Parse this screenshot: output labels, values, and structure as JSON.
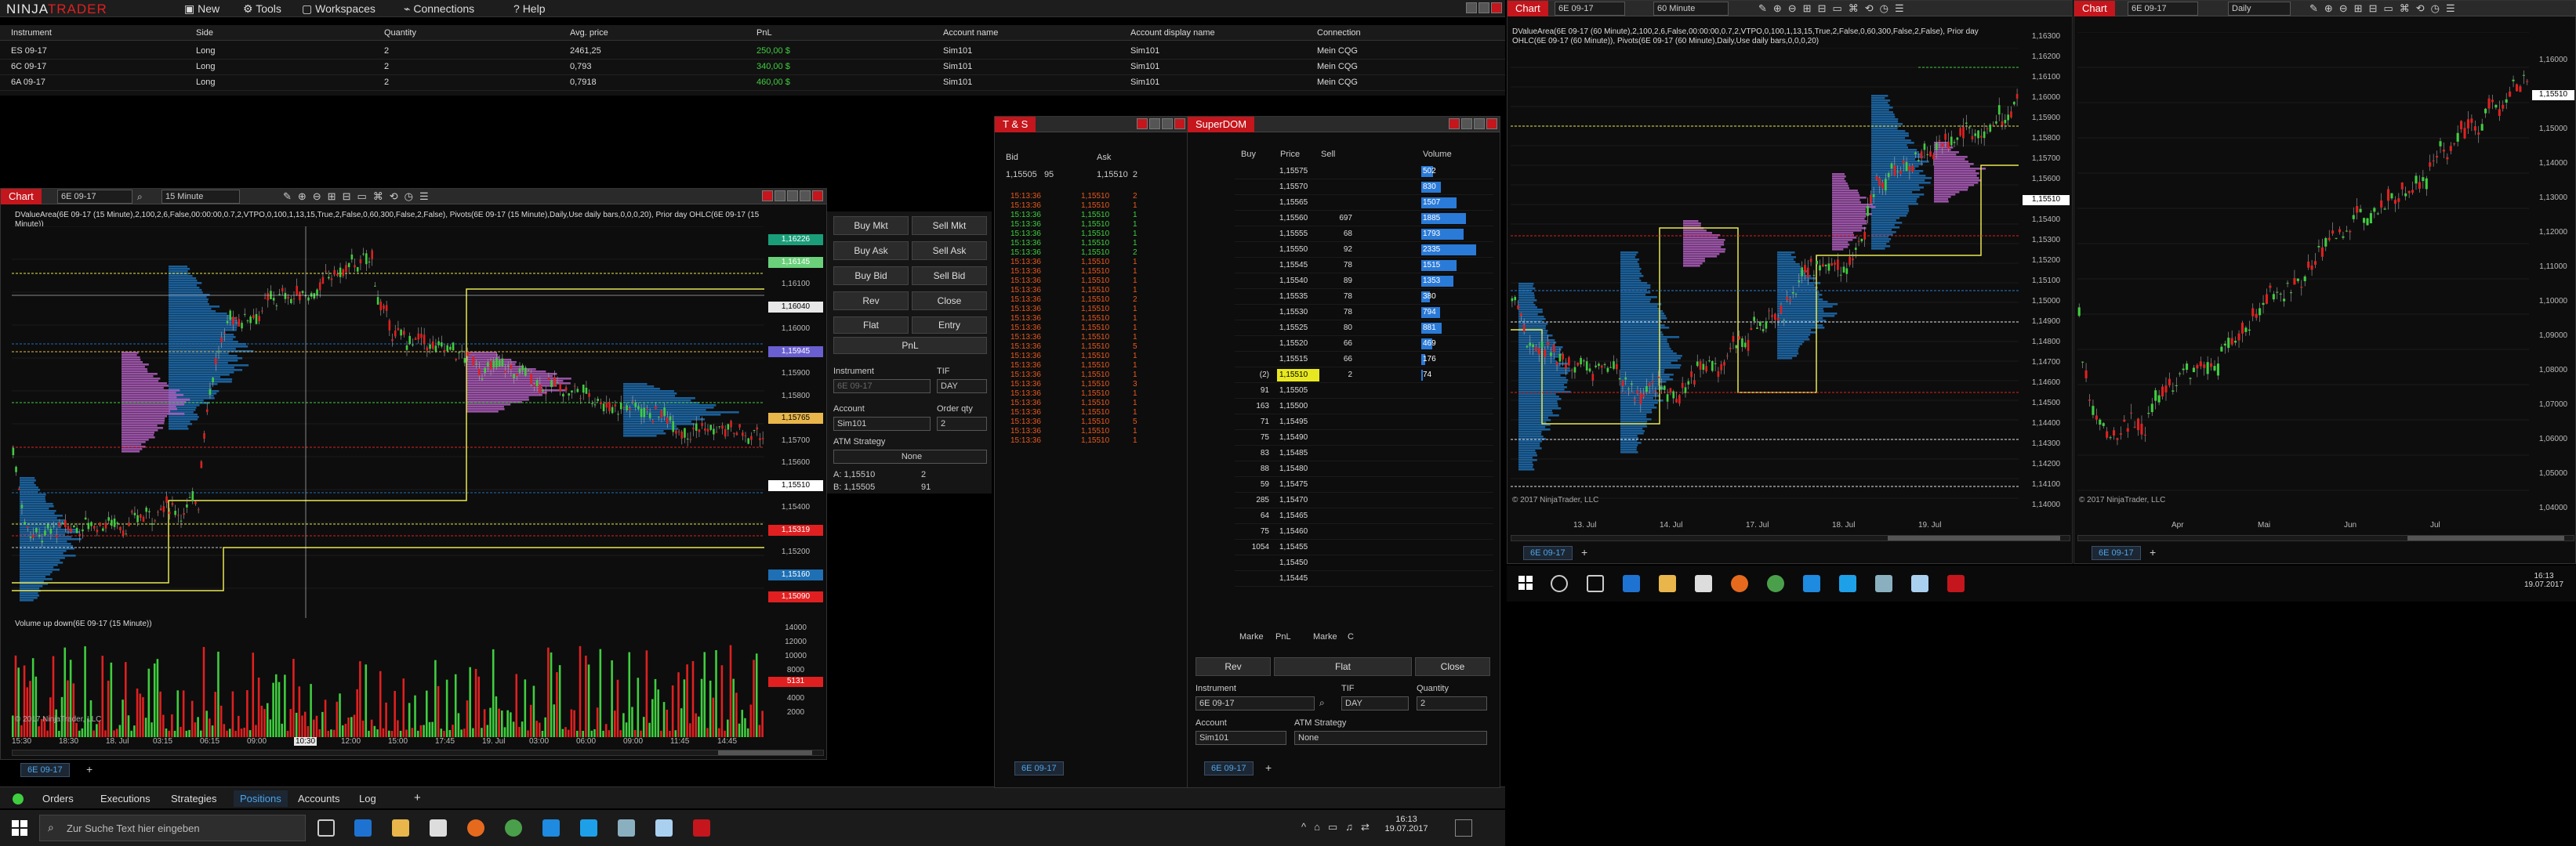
{
  "app": {
    "logo_left": "NINJA",
    "logo_right": "TRADER",
    "menu": [
      "New",
      "Tools",
      "Workspaces",
      "Connections",
      "Help"
    ]
  },
  "positions": {
    "headers": [
      "Instrument",
      "Side",
      "Quantity",
      "Avg. price",
      "PnL",
      "Account name",
      "Account display name",
      "Connection"
    ],
    "rows": [
      [
        "ES 09-17",
        "Long",
        "2",
        "2461,25",
        "250,00 $",
        "Sim101",
        "Sim101",
        "Mein CQG"
      ],
      [
        "6C 09-17",
        "Long",
        "2",
        "0,793",
        "340,00 $",
        "Sim101",
        "Sim101",
        "Mein CQG"
      ],
      [
        "6A 09-17",
        "Long",
        "2",
        "0,7918",
        "460,00 $",
        "Sim101",
        "Sim101",
        "Mein CQG"
      ]
    ]
  },
  "cc_tabs": [
    "Orders",
    "Executions",
    "Strategies",
    "Positions",
    "Accounts",
    "Log"
  ],
  "chart1": {
    "title": "Chart",
    "instrument": "6E 09-17",
    "interval": "15 Minute",
    "indicator_text": "DValueArea(6E 09-17 (15 Minute),2,100,2,6,False,00:00:00,0.7,2,VTPO,0,100,1,13,15,True,2,False,0,60,300,False,2,False), Pivots(6E 09-17 (15 Minute),Daily,Use daily bars,0,0,0,20), Prior day OHLC(6E 09-17 (15 Minute))",
    "price_labels": [
      "1,16226",
      "1,16145",
      "1,16100",
      "1,16040",
      "1,16000",
      "1,15945",
      "1,15900",
      "1,15800",
      "1,15765",
      "1,15700",
      "1,15600",
      "1,15510",
      "1,15400",
      "1,15319",
      "1,15200",
      "1,15160",
      "1,15090"
    ],
    "volume_title": "Volume up down(6E 09-17 (15 Minute))",
    "volume_labels": [
      "14000",
      "12000",
      "10000",
      "8000",
      "6000",
      "4000",
      "2000",
      "5131"
    ],
    "time_labels": [
      "15:30",
      "18:30",
      "18. Jul",
      "03:15",
      "06:15",
      "09:00",
      "10:30",
      "12:00",
      "15:00",
      "17:45",
      "19. Jul",
      "03:00",
      "06:00",
      "09:00",
      "11:45",
      "14:45"
    ],
    "copyright": "© 2017 NinjaTrader, LLC",
    "tab": "6E 09-17",
    "chart_trader": {
      "buttons": [
        "Buy Mkt",
        "Sell Mkt",
        "Buy Ask",
        "Sell Ask",
        "Buy Bid",
        "Sell Bid",
        "Rev",
        "Close"
      ],
      "flat": "Flat",
      "entry": "Entry",
      "pnl": "PnL",
      "instrument_label": "Instrument",
      "instrument_value": "6E 09-17",
      "tif_label": "TIF",
      "tif_value": "DAY",
      "account_label": "Account",
      "account_value": "Sim101",
      "qty_label": "Order qty",
      "qty_value": "2",
      "atm_label": "ATM Strategy",
      "atm_value": "None",
      "quote_a": "A: 1,15510",
      "quote_a_size": "2",
      "quote_b": "B: 1,15505",
      "quote_b_size": "91"
    }
  },
  "ts": {
    "title": "T & S",
    "col_bid": "Bid",
    "col_ask": "Ask",
    "bid": "1,15505",
    "bid_size": "95",
    "ask": "1,15510",
    "ask_size": "2",
    "tab": "6E 09-17",
    "rows": [
      [
        "15:13:36",
        "1,15510",
        "2",
        "r"
      ],
      [
        "15:13:36",
        "1,15510",
        "1",
        "r"
      ],
      [
        "15:13:36",
        "1,15510",
        "1",
        "g"
      ],
      [
        "15:13:36",
        "1,15510",
        "1",
        "g"
      ],
      [
        "15:13:36",
        "1,15510",
        "1",
        "g"
      ],
      [
        "15:13:36",
        "1,15510",
        "1",
        "g"
      ],
      [
        "15:13:36",
        "1,15510",
        "2",
        "g"
      ],
      [
        "15:13:36",
        "1,15510",
        "1",
        "r"
      ],
      [
        "15:13:36",
        "1,15510",
        "1",
        "r"
      ],
      [
        "15:13:36",
        "1,15510",
        "1",
        "r"
      ],
      [
        "15:13:36",
        "1,15510",
        "1",
        "r"
      ],
      [
        "15:13:36",
        "1,15510",
        "2",
        "r"
      ],
      [
        "15:13:36",
        "1,15510",
        "1",
        "r"
      ],
      [
        "15:13:36",
        "1,15510",
        "1",
        "r"
      ],
      [
        "15:13:36",
        "1,15510",
        "1",
        "r"
      ],
      [
        "15:13:36",
        "1,15510",
        "1",
        "r"
      ],
      [
        "15:13:36",
        "1,15510",
        "5",
        "r"
      ],
      [
        "15:13:36",
        "1,15510",
        "1",
        "r"
      ],
      [
        "15:13:36",
        "1,15510",
        "1",
        "r"
      ],
      [
        "15:13:36",
        "1,15510",
        "1",
        "r"
      ],
      [
        "15:13:36",
        "1,15510",
        "3",
        "r"
      ],
      [
        "15:13:36",
        "1,15510",
        "1",
        "r"
      ],
      [
        "15:13:36",
        "1,15510",
        "1",
        "r"
      ],
      [
        "15:13:36",
        "1,15510",
        "1",
        "r"
      ],
      [
        "15:13:36",
        "1,15510",
        "5",
        "r"
      ],
      [
        "15:13:36",
        "1,15510",
        "1",
        "r"
      ],
      [
        "15:13:36",
        "1,15510",
        "1",
        "r"
      ]
    ]
  },
  "superdom": {
    "title": "SuperDOM",
    "headers": [
      "Buy",
      "Price",
      "Sell",
      "Volume"
    ],
    "rows": [
      [
        "",
        "1,15575",
        "",
        "502"
      ],
      [
        "",
        "1,15570",
        "",
        "830"
      ],
      [
        "",
        "1,15565",
        "",
        "1507"
      ],
      [
        "",
        "1,15560",
        "697",
        "1885"
      ],
      [
        "",
        "1,15555",
        "68",
        "1793"
      ],
      [
        "",
        "1,15550",
        "92",
        "2335"
      ],
      [
        "",
        "1,15545",
        "78",
        "1515"
      ],
      [
        "",
        "1,15540",
        "89",
        "1353"
      ],
      [
        "",
        "1,15535",
        "78",
        "380"
      ],
      [
        "",
        "1,15530",
        "78",
        "794"
      ],
      [
        "",
        "1,15525",
        "80",
        "881"
      ],
      [
        "",
        "1,15520",
        "66",
        "469"
      ],
      [
        "",
        "1,15515",
        "66",
        "176"
      ],
      [
        "(2)",
        "1,15510",
        "2",
        "74"
      ],
      [
        "91",
        "1,15505",
        "",
        ""
      ],
      [
        "163",
        "1,15500",
        "",
        ""
      ],
      [
        "71",
        "1,15495",
        "",
        ""
      ],
      [
        "75",
        "1,15490",
        "",
        ""
      ],
      [
        "83",
        "1,15485",
        "",
        ""
      ],
      [
        "88",
        "1,15480",
        "",
        ""
      ],
      [
        "59",
        "1,15475",
        "",
        ""
      ],
      [
        "285",
        "1,15470",
        "",
        ""
      ],
      [
        "64",
        "1,15465",
        "",
        ""
      ],
      [
        "75",
        "1,15460",
        "",
        ""
      ],
      [
        "1054",
        "1,15455",
        "",
        ""
      ],
      [
        "",
        "1,15450",
        "",
        ""
      ],
      [
        "",
        "1,15445",
        "",
        ""
      ]
    ],
    "volume_values": [
      502,
      830,
      1507,
      1885,
      1793,
      2335,
      1515,
      1353,
      380,
      794,
      881,
      469,
      176,
      74
    ],
    "footer": [
      "Marke",
      "PnL",
      "Marke",
      "C"
    ],
    "rev": "Rev",
    "flat": "Flat",
    "close": "Close",
    "instrument_label": "Instrument",
    "instrument_value": "6E 09-17",
    "tif_label": "TIF",
    "tif_value": "DAY",
    "qty_label": "Quantity",
    "qty_value": "2",
    "account_label": "Account",
    "account_value": "Sim101",
    "atm_label": "ATM Strategy",
    "atm_value": "None",
    "tab": "6E 09-17"
  },
  "chart2": {
    "title": "Chart",
    "instrument": "6E 09-17",
    "interval": "60 Minute",
    "indicator_text": "DValueArea(6E 09-17 (60 Minute),2,100,2,6,False,00:00:00,0.7,2,VTPO,0,100,1,13,15,True,2,False,0,60,300,False,2,False), Prior day OHLC(6E 09-17 (60 Minute)), Pivots(6E 09-17 (60 Minute),Daily,Use daily bars,0,0,0,20)",
    "price_labels": [
      "1,16300",
      "1,16200",
      "1,16100",
      "1,16000",
      "1,15900",
      "1,15800",
      "1,15700",
      "1,15600",
      "1,15510",
      "1,15400",
      "1,15300",
      "1,15200",
      "1,15100",
      "1,15000",
      "1,14900",
      "1,14800",
      "1,14700",
      "1,14600",
      "1,14500",
      "1,14400",
      "1,14300",
      "1,14200",
      "1,14100",
      "1,14000"
    ],
    "time_labels": [
      "13. Jul",
      "14. Jul",
      "17. Jul",
      "18. Jul",
      "19. Jul"
    ],
    "copyright": "© 2017 NinjaTrader, LLC",
    "tab": "6E 09-17"
  },
  "chart3": {
    "title": "Chart",
    "instrument": "6E 09-17",
    "interval": "Daily",
    "price_labels": [
      "1,16000",
      "1,15510",
      "1,15000",
      "1,14000",
      "1,13000",
      "1,12000",
      "1,11000",
      "1,10000",
      "1,09000",
      "1,08000",
      "1,07000",
      "1,06000",
      "1,05000",
      "1,04000"
    ],
    "time_labels": [
      "Apr",
      "Mai",
      "Jun",
      "Jul"
    ],
    "copyright": "© 2017 NinjaTrader, LLC",
    "tab": "6E 09-17"
  },
  "taskbar_left": {
    "search_placeholder": "Zur Suche Text hier eingeben",
    "time": "16:13",
    "date": "19.07.2017"
  },
  "taskbar_right": {
    "time": "16:13",
    "date": "19.07.2017"
  },
  "colors": {
    "accent": "#c4161c",
    "up": "#3fce3f",
    "down": "#e02020",
    "vp_blue": "#1e6fb3",
    "vp_purple": "#b25fc0",
    "ask_tag": "#e8b64a",
    "bid_tag": "#1e6fb3"
  }
}
